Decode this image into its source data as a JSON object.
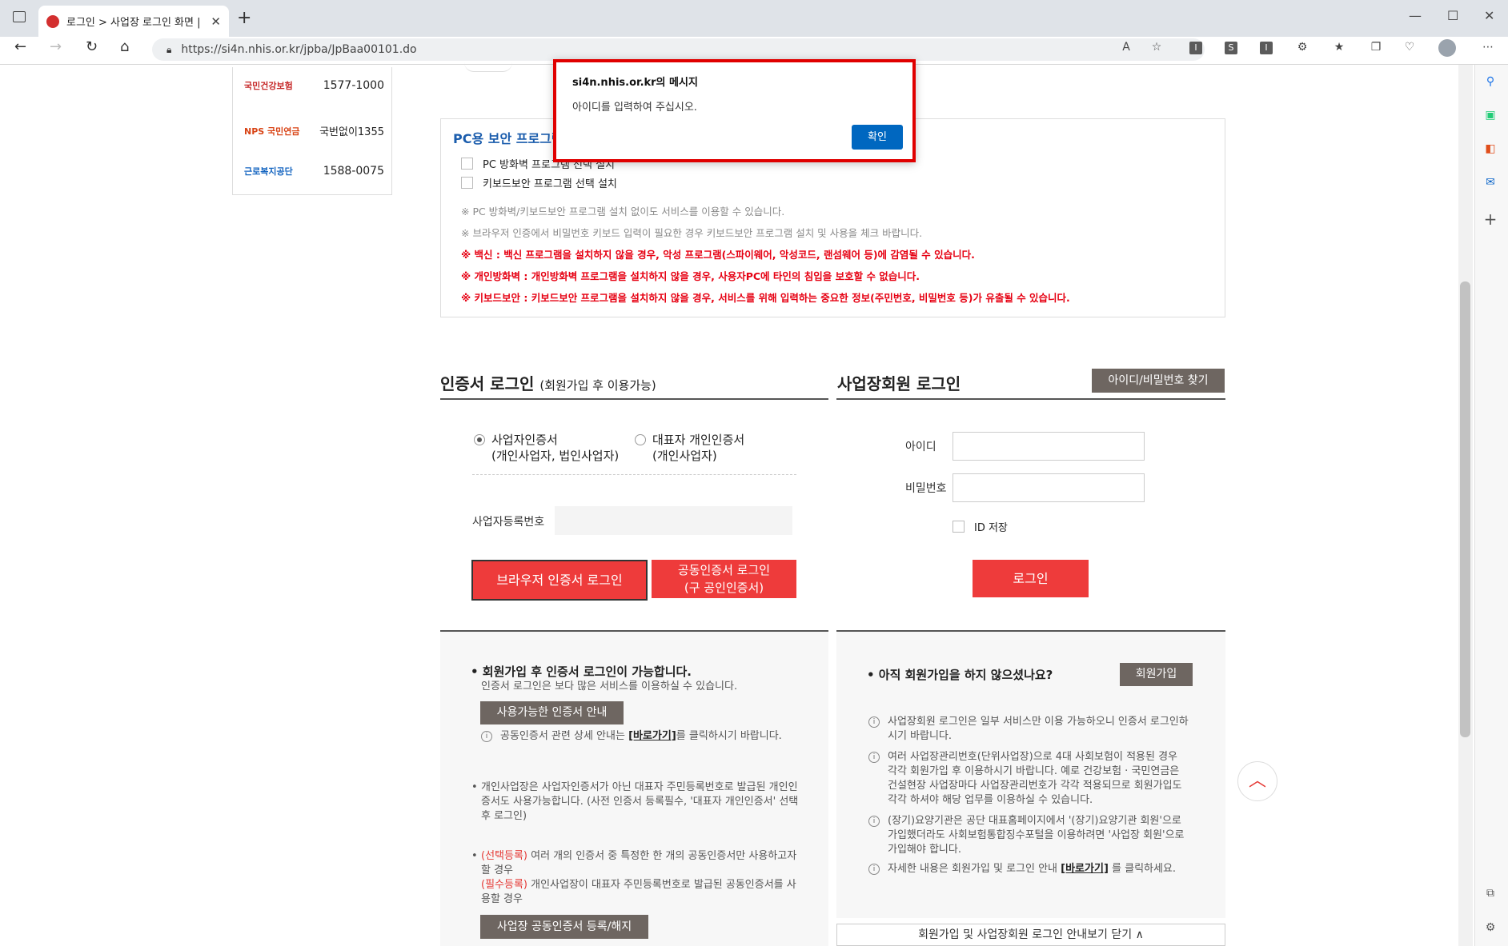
{
  "browser": {
    "tab_title": "로그인 > 사업장 로그인 화면 | h",
    "tab_close": "✕",
    "new_tab": "+",
    "url": "https://si4n.nhis.or.kr/jpba/JpBaa00101.do",
    "win_min": "—",
    "win_max": "☐",
    "win_close": "✕"
  },
  "phones": [
    {
      "org": "국민건강보험",
      "number": "1577-1000"
    },
    {
      "org": "NPS 국민연금",
      "number": "국번없이1355"
    },
    {
      "org": "근로복지공단",
      "number": "1588-0075"
    }
  ],
  "security": {
    "title": "PC용 보안 프로그램",
    "option1": "PC 방화벽 프로그램 선택 설치",
    "option2": "키보드보안 프로그램 선택 설치",
    "notes": [
      "※ PC 방화벽/키보드보안 프로그램 설치 없이도 서비스를 이용할 수 있습니다.",
      "※ 브라우저 인증에서 비밀번호 키보드 입력이 필요한 경우 키보드보안 프로그램 설치 및 사용을 체크 바랍니다."
    ],
    "warnings": [
      "※ 백신 : 백신 프로그램을 설치하지 않을 경우, 악성 프로그램(스파이웨어, 악성코드, 랜섬웨어 등)에 감염될 수 있습니다.",
      "※ 개인방화벽 : 개인방화벽 프로그램을 설치하지 않을 경우, 사용자PC에 타인의 침입을 보호할 수 없습니다.",
      "※ 키보드보안 : 키보드보안 프로그램을 설치하지 않을 경우, 서비스를 위해 입력하는 중요한 정보(주민번호, 비밀번호 등)가 유출될 수 있습니다."
    ]
  },
  "cert_login": {
    "title": "인증서 로그인",
    "subtitle": "(회원가입 후 이용가능)",
    "radio1": "사업자인증서",
    "radio1_sub": "(개인사업자, 법인사업자)",
    "radio2": "대표자 개인인증서",
    "radio2_sub": "(개인사업자)",
    "biz_no_label": "사업자등록번호",
    "browser_btn": "브라우저 인증서 로그인",
    "joint_btn_1": "공동인증서 로그인",
    "joint_btn_2": "(구 공인인증서)"
  },
  "member_login": {
    "title": "사업장회원 로그인",
    "find_btn": "아이디/비밀번호 찾기",
    "id_label": "아이디",
    "pw_label": "비밀번호",
    "save_id": "ID 저장",
    "login_btn": "로그인"
  },
  "panel_left": {
    "heading": "• 회원가입 후 인증서 로그인이 가능합니다.",
    "sub": "인증서 로그인은 보다 많은 서비스를 이용하실 수 있습니다.",
    "cert_btn": "사용가능한 인증서 안내",
    "info1_a": "공동인증서 관련 상세 안내는 ",
    "info1_link": "[바로가기]",
    "info1_b": "를 클릭하시기 바랍니다.",
    "para2": "개인사업장은 사업자인증서가 아닌 대표자 주민등록번호로 발급된 개인인증서도 사용가능합니다. (사전 인증서 등록필수, '대표자 개인인증서' 선택 후 로그인)",
    "opt_tag": "(선택등록)",
    "opt_text": " 여러 개의 인증서 중 특정한 한 개의 공동인증서만 사용하고자 할 경우",
    "req_tag": "(필수등록)",
    "req_text": " 개인사업장이 대표자 주민등록번호로 발급된 공동인증서를 사용할 경우",
    "reg_btn": "사업장 공동인증서 등록/해지"
  },
  "panel_right": {
    "heading": "• 아직 회원가입을 하지 않으셨나요?",
    "join_btn": "회원가입",
    "info1": "사업장회원 로그인은 일부 서비스만 이용 가능하오니 인증서 로그인하시기 바랍니다.",
    "info2": "여러 사업장관리번호(단위사업장)으로 4대 사회보험이 적용된 경우 각각 회원가입 후 이용하시기 바랍니다. 예로 건강보험 · 국민연금은 건설현장 사업장마다 사업장관리번호가 각각 적용되므로 회원가입도 각각 하셔야 해당 업무를 이용하실 수 있습니다.",
    "info3": "(장기)요양기관은 공단 대표홈페이지에서 '(장기)요양기관 회원'으로 가입했더라도 사회보험통합징수포털을 이용하려면 '사업장 회원'으로 가입해야 합니다.",
    "info4_a": "자세한 내용은 회원가입 및 로그인 안내 ",
    "info4_link": "[바로가기]",
    "info4_b": " 를 클릭하세요.",
    "close_bar": "회원가입 및 사업장회원 로그인 안내보기 닫기 ∧"
  },
  "dialog": {
    "title": "si4n.nhis.or.kr의 메시지",
    "message": "아이디를 입력하여 주십시오.",
    "ok": "확인"
  }
}
